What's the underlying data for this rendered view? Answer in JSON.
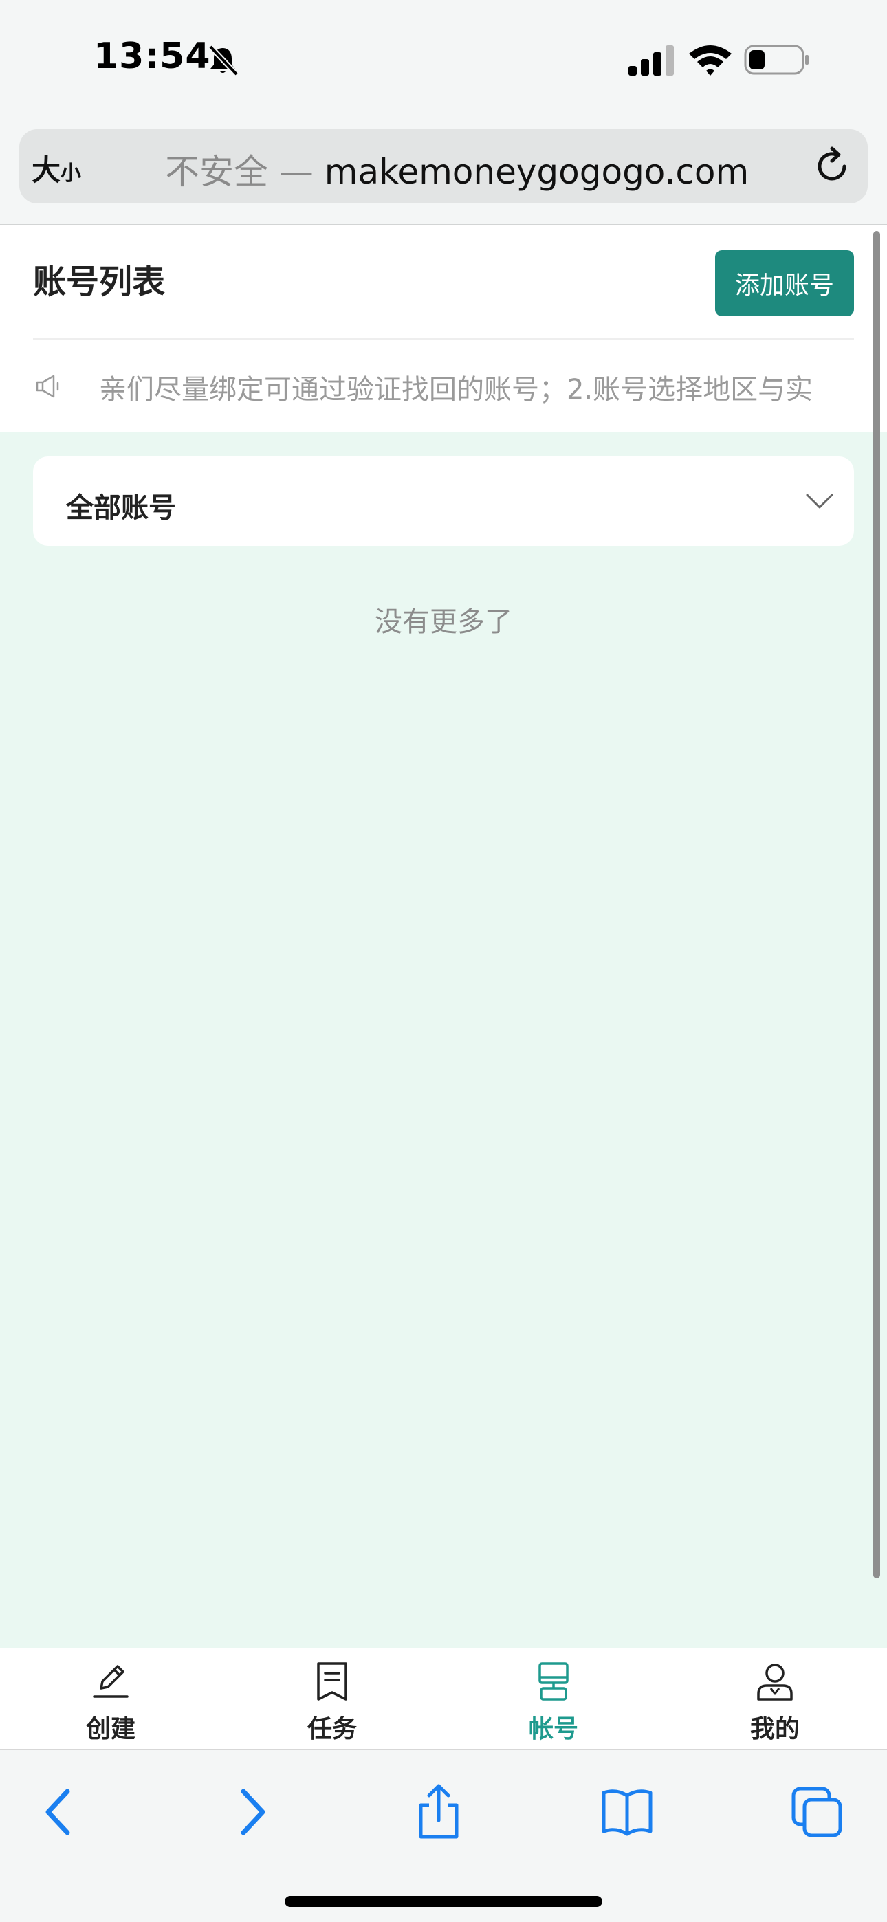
{
  "status_bar": {
    "time": "13:54"
  },
  "browser": {
    "text_size_large": "大",
    "text_size_small": "小",
    "url_insecure": "不安全 — ",
    "url_domain": "makemoneygogogo.com"
  },
  "page": {
    "title": "账号列表",
    "add_button_label": "添加账号",
    "notice": "亲们尽量绑定可通过验证找回的账号；2.账号选择地区与实",
    "filter": {
      "selected": "全部账号"
    },
    "no_more": "没有更多了"
  },
  "tabs": [
    {
      "label": "创建",
      "icon": "pencil-icon"
    },
    {
      "label": "任务",
      "icon": "document-icon"
    },
    {
      "label": "帐号",
      "icon": "account-icon",
      "active": true
    },
    {
      "label": "我的",
      "icon": "user-icon"
    }
  ],
  "colors": {
    "accent": "#1e8a7e",
    "active_tab": "#1e9a8e",
    "page_bg": "#eaf8f2",
    "browser_blue": "#1a7ff0"
  }
}
